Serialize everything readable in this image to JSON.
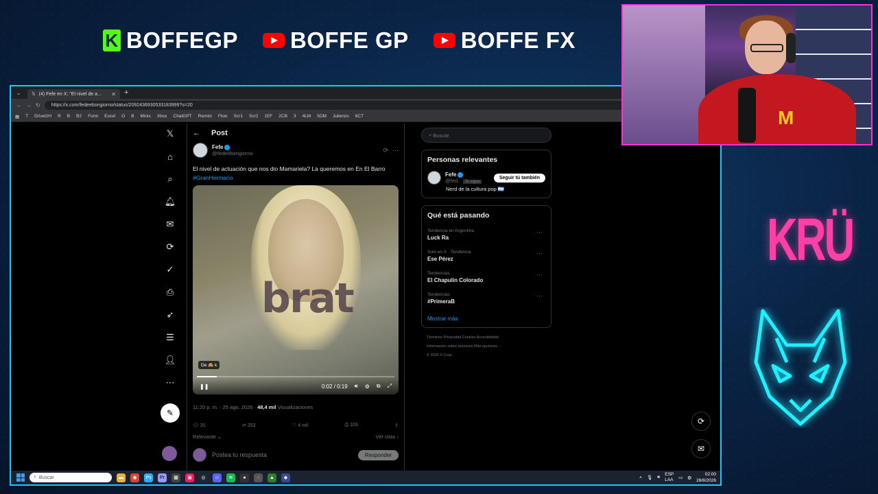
{
  "overlay": {
    "handles": [
      {
        "platform": "kick",
        "name": "BOFFEGP"
      },
      {
        "platform": "youtube",
        "name": "BOFFE GP"
      },
      {
        "platform": "youtube",
        "name": "BOFFE FX"
      }
    ],
    "kru_logo": "KRÜ",
    "wolf_icon": "wolf-logo-icon",
    "colors": {
      "kick": "#53fc18",
      "youtube": "#ff0000",
      "browser_border": "#1ec8ff",
      "cam_border": "#ff2fd6",
      "kru": "#ff3fa8",
      "wolf": "#1ef0ff"
    }
  },
  "browser": {
    "tab_title": "(4) Fefe en X: \"El nivel de a...",
    "url": "https://x.com/fedeebongiorno/status/2092436930533183999?s=20",
    "bookmarks": [
      "T",
      "DriveGH",
      "R",
      "B",
      "B2",
      "Form",
      "Excel",
      "O",
      "B",
      "Minis",
      "Xbox",
      "ChatGPT",
      "Remini",
      "Flow",
      "Scr1",
      "Scr2",
      "1EF",
      "2CB",
      "3",
      "4LM",
      "5DM",
      "Julienzo",
      "6CT"
    ]
  },
  "x": {
    "nav_icons": [
      "x-logo-icon",
      "home-icon",
      "search-icon",
      "notifications-icon",
      "messages-icon",
      "grok-icon",
      "verified-icon",
      "bookmarks-icon",
      "rocket-icon",
      "lists-icon",
      "profile-icon",
      "more-icon"
    ],
    "post_header": "Post",
    "author_name": "Fefe",
    "author_handle": "@fedeebongiorno",
    "tweet_text": "El nivel de actuación que nos dio Mamariela? La queremos en En El Barro",
    "hashtag": "#GranHermano",
    "video": {
      "overlay_text": "brat",
      "badge": "De 🙈 k",
      "time": "0:02 / 0:19",
      "progress": 0.1
    },
    "meta_time": "11:20 p. m. · 25 ago. 2026 ·",
    "views": "48,4 mil",
    "views_label": "Visualizaciones",
    "actions": {
      "replies": "31",
      "reposts": "253",
      "likes": "4 mil",
      "bookmarks": "103"
    },
    "relevant": "Relevante",
    "quotes": "Ver citas",
    "reply_placeholder": "Postea tu respuesta",
    "reply_button": "Responder",
    "search_placeholder": "Buscar",
    "people_title": "Personas relevantes",
    "person": {
      "name": "Fefe",
      "handle": "@fed...",
      "follows_you": "Te sigue",
      "follow_btn": "Seguir tú también",
      "bio": "Nerd de la cultura pop 🇦🇷"
    },
    "trending_title": "Qué está pasando",
    "trends": [
      {
        "category": "Tendencia en Argentina",
        "name": "Luck Ra"
      },
      {
        "category": "Solo en X · Tendencia",
        "name": "Ese Pérez"
      },
      {
        "category": "Tendencias",
        "name": "El Chapulín Colorado"
      },
      {
        "category": "Tendencias",
        "name": "#PrimeraB"
      }
    ],
    "show_more": "Mostrar más",
    "footer_line1": "Términos      Privacidad      Cookies      Accesibilidad",
    "footer_line2": "Información sobre anuncios      Más opciones ···",
    "footer_line3": "© 2026 X Corp."
  },
  "taskbar": {
    "search": "Buscar",
    "lang": "ESP",
    "lang2": "LAA",
    "time": "02:00",
    "date": "26/8/2026"
  }
}
